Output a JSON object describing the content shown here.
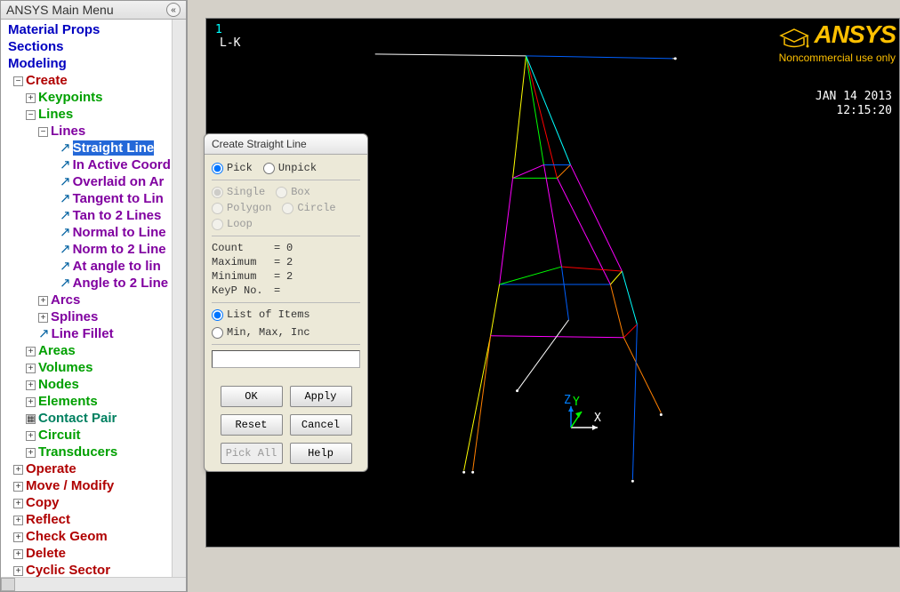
{
  "sidebar": {
    "title": "ANSYS Main Menu",
    "items": {
      "material_props": "Material Props",
      "sections": "Sections",
      "modeling": "Modeling",
      "create": "Create",
      "keypoints": "Keypoints",
      "lines": "Lines",
      "lines_sub": "Lines",
      "straight_line": "Straight Line",
      "in_active_coord": "In Active Coord",
      "overlaid_on_area": "Overlaid on Ar",
      "tangent_to_line": "Tangent to Lin",
      "tan_to_2_lines": "Tan to 2 Lines",
      "normal_to_line": "Normal to Line",
      "norm_to_2_lines": "Norm to 2 Line",
      "at_angle_to_line": "At angle to lin",
      "angle_to_2_lines": "Angle to 2 Line",
      "arcs": "Arcs",
      "splines": "Splines",
      "line_fillet": "Line Fillet",
      "areas": "Areas",
      "volumes": "Volumes",
      "nodes": "Nodes",
      "elements": "Elements",
      "contact_pair": "Contact Pair",
      "circuit": "Circuit",
      "transducers": "Transducers",
      "operate": "Operate",
      "move_modify": "Move / Modify",
      "copy": "Copy",
      "reflect": "Reflect",
      "check_geom": "Check Geom",
      "delete": "Delete",
      "cyclic_sector": "Cyclic Sector"
    }
  },
  "canvas": {
    "index": "1",
    "mode": "L-K",
    "date": "JAN 14 2013",
    "time": "12:15:20",
    "logo_main": "ANSYS",
    "logo_sub": "Noncommercial use only",
    "axis_x": "X",
    "axis_y": "Y",
    "axis_z": "Z"
  },
  "dialog": {
    "title": "Create Straight Line",
    "pick": "Pick",
    "unpick": "Unpick",
    "single": "Single",
    "box": "Box",
    "polygon": "Polygon",
    "circle": "Circle",
    "loop": "Loop",
    "count_k": "Count",
    "count_v": "0",
    "max_k": "Maximum",
    "max_v": "2",
    "min_k": "Minimum",
    "min_v": "2",
    "keyp_k": "KeyP No.",
    "list_items": "List of Items",
    "min_max_inc": "Min, Max, Inc",
    "input_value": "",
    "btn_ok": "OK",
    "btn_apply": "Apply",
    "btn_reset": "Reset",
    "btn_cancel": "Cancel",
    "btn_pick_all": "Pick All",
    "btn_help": "Help"
  }
}
